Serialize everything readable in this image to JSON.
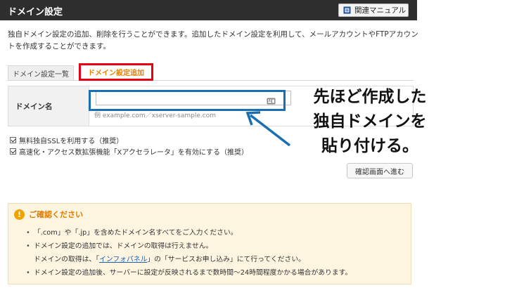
{
  "header": {
    "title": "ドメイン設定",
    "manual_label": "関連マニュアル"
  },
  "intro": "独自ドメイン設定の追加、削除を行うことができます。追加したドメイン設定を利用して、メールアカウントやFTPアカウントを作成することができます。",
  "tabs": [
    {
      "label": "ドメイン設定一覧"
    },
    {
      "label": "ドメイン設定追加"
    }
  ],
  "form": {
    "domain_label": "ドメイン名",
    "domain_value": "",
    "example": "例  example.com／xserver-sample.com"
  },
  "options": [
    {
      "label": "無料独自SSLを利用する（推奨）",
      "checked": true
    },
    {
      "label": "高速化・アクセス数拡張機能「Xアクセラレータ」を有効にする（推奨）",
      "checked": true
    }
  ],
  "confirm_button": "確認画面へ進む",
  "annotation": {
    "line1": "先ほど作成した",
    "line2": "独自ドメインを",
    "line3": "貼り付ける。"
  },
  "notice": {
    "title": "ご確認ください",
    "item1": "「.com」や「.jp」を含めたドメイン名すべてをご入力ください。",
    "item2": "ドメイン設定の追加では、ドメインの取得は行えません。",
    "item3_pre": "ドメインの取得は、「",
    "item3_link": "インフォパネル",
    "item3_post": "」の「サービスお申し込み」にて行ってください。",
    "item4": "ドメイン設定の追加後、サーバーに設定が反映されるまで数時間～24時間程度かかる場合があります。"
  },
  "colors": {
    "tab_highlight": "#e60012",
    "annotation_blue": "#1a6fb3",
    "accent_orange": "#e87f00"
  },
  "icons": [
    "book-icon",
    "paste-icon",
    "alert-icon",
    "checkbox-checked-icon"
  ]
}
